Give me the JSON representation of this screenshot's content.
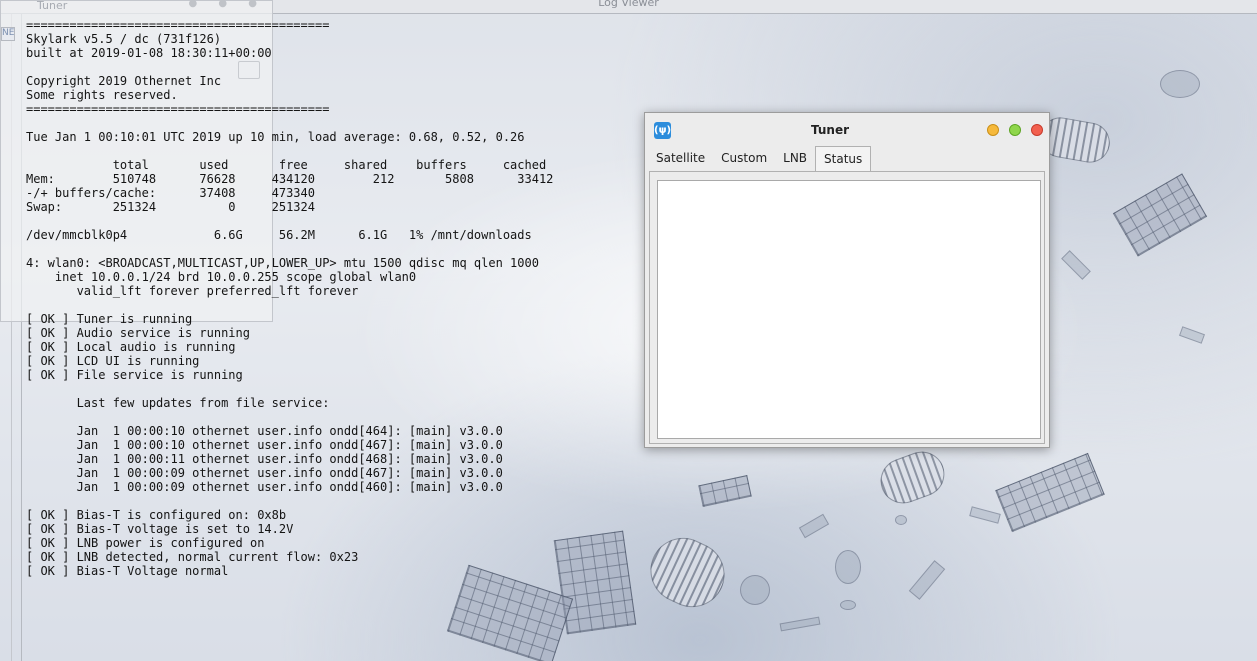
{
  "background_window": {
    "title": "Log Viewer",
    "ghost_window_title": "Tuner",
    "ghost_tab_fragment": "NE"
  },
  "log_lines": [
    "==========================================",
    "Skylark v5.5 / dc (731f126)",
    "built at 2019-01-08 18:30:11+00:00",
    "",
    "Copyright 2019 Othernet Inc",
    "Some rights reserved.",
    "==========================================",
    "",
    "Tue Jan 1 00:10:01 UTC 2019 up 10 min, load average: 0.68, 0.52, 0.26",
    "",
    "            total       used       free     shared    buffers     cached",
    "Mem:        510748      76628     434120        212       5808      33412",
    "-/+ buffers/cache:      37408     473340",
    "Swap:       251324          0     251324",
    "",
    "/dev/mmcblk0p4            6.6G     56.2M      6.1G   1% /mnt/downloads",
    "",
    "4: wlan0: <BROADCAST,MULTICAST,UP,LOWER_UP> mtu 1500 qdisc mq qlen 1000",
    "    inet 10.0.0.1/24 brd 10.0.0.255 scope global wlan0",
    "       valid_lft forever preferred_lft forever",
    "",
    "[ OK ] Tuner is running",
    "[ OK ] Audio service is running",
    "[ OK ] Local audio is running",
    "[ OK ] LCD UI is running",
    "[ OK ] File service is running",
    "",
    "       Last few updates from file service:",
    "",
    "       Jan  1 00:00:10 othernet user.info ondd[464]: [main] v3.0.0",
    "       Jan  1 00:00:10 othernet user.info ondd[467]: [main] v3.0.0",
    "       Jan  1 00:00:11 othernet user.info ondd[468]: [main] v3.0.0",
    "       Jan  1 00:00:09 othernet user.info ondd[467]: [main] v3.0.0",
    "       Jan  1 00:00:09 othernet user.info ondd[460]: [main] v3.0.0",
    "",
    "[ OK ] Bias-T is configured on: 0x8b",
    "[ OK ] Bias-T voltage is set to 14.2V",
    "[ OK ] LNB power is configured on",
    "[ OK ] LNB detected, normal current flow: 0x23",
    "[ OK ] Bias-T Voltage normal"
  ],
  "tuner_window": {
    "title": "Tuner",
    "app_icon": "antenna-icon",
    "tabs": [
      "Satellite",
      "Custom",
      "LNB",
      "Status"
    ],
    "active_tab": "Status",
    "colors": {
      "minimize": "#f6b93b",
      "maximize": "#8fd64b",
      "close": "#f2604f",
      "app_icon": "#2c8ddc"
    }
  }
}
